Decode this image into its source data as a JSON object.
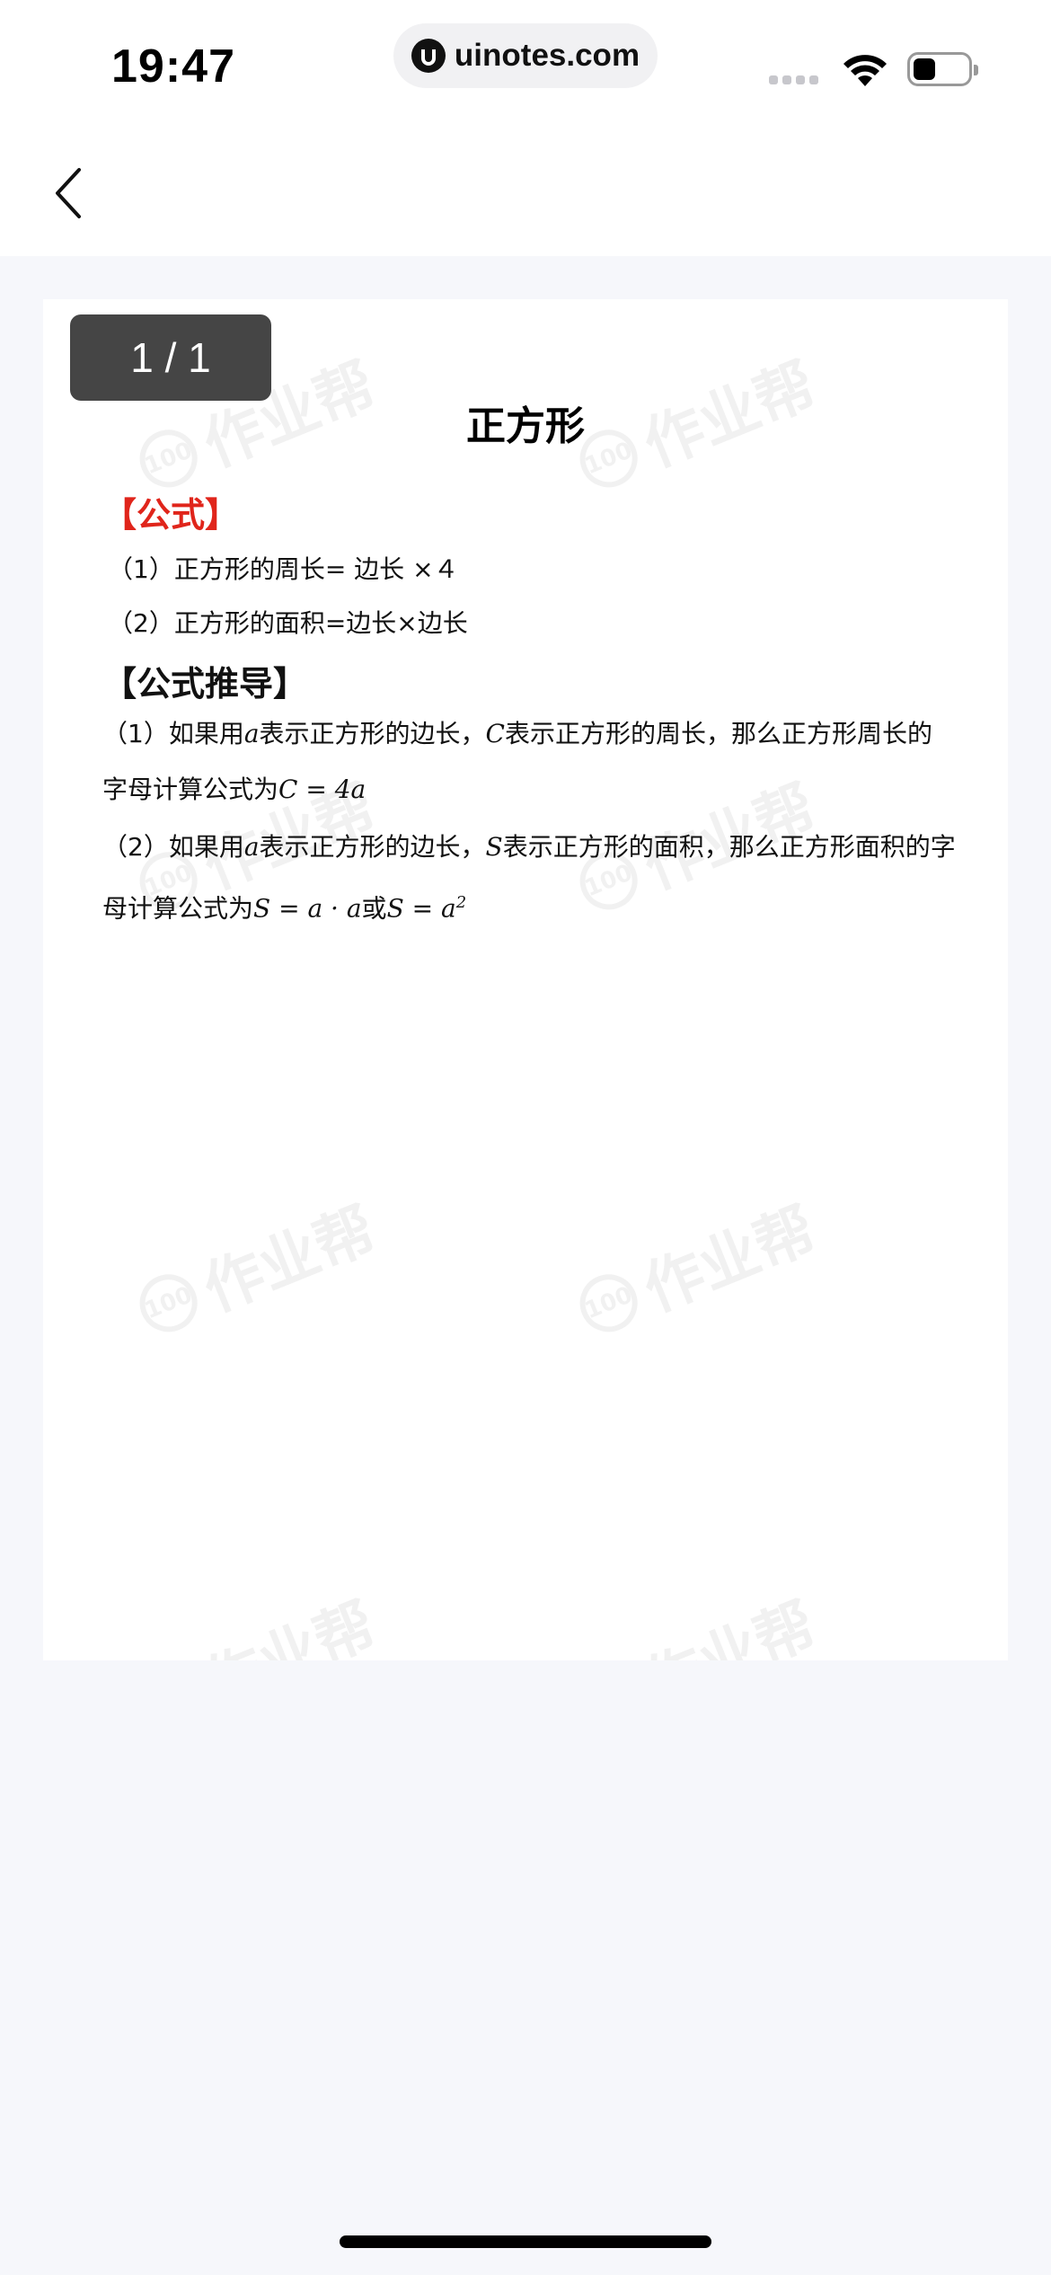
{
  "status_bar": {
    "time": "19:47",
    "url": "uinotes.com"
  },
  "nav": {
    "back_icon": "chevron-left-icon"
  },
  "pager": {
    "label": "1 / 1"
  },
  "document": {
    "title": "正方形",
    "section_formula": "【公式】",
    "formula_lines": [
      "（1）正方形的周长= 边长 ×４",
      "（2）正方形的面积=边长×边长"
    ],
    "section_derivation": "【公式推导】",
    "derivation_1": {
      "pre1": "（1）如果用",
      "var_a": "a",
      "mid1": "表示正方形的边长，",
      "var_c": "C",
      "mid2": "表示正方形的周长，那么正方形周长的字母计算公式为",
      "formula": "C = 4a"
    },
    "derivation_2": {
      "pre1": "（2）如果用",
      "var_a": "a",
      "mid1": "表示正方形的边长，",
      "var_s": "S",
      "mid2": "表示正方形的面积，那么正方形面积的字母计算公式为",
      "formula1": "S = a · a",
      "or": "或",
      "formula2": "S = a",
      "exp": "2"
    },
    "watermark": "作业帮",
    "watermark_badge": "100"
  },
  "colors": {
    "accent_red": "#e0251b",
    "pager_bg": "#454545",
    "page_bg": "#f6f7fb"
  }
}
